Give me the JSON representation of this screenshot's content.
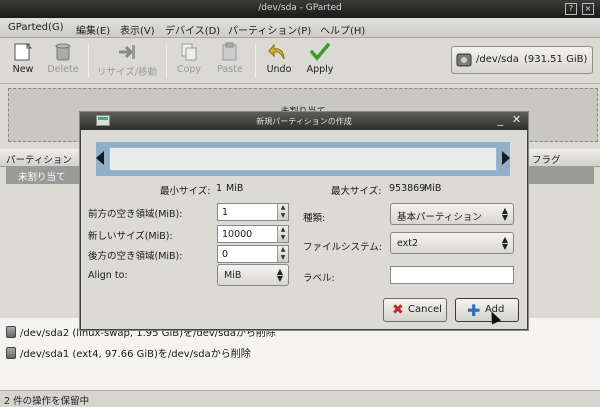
{
  "window": {
    "title": "/dev/sda - GParted",
    "controls": [
      "?",
      "×"
    ]
  },
  "menubar": [
    "GParted(G)",
    "編集(E)",
    "表示(V)",
    "デバイス(D)",
    "パーティション(P)",
    "ヘルプ(H)"
  ],
  "toolbar": {
    "new": "New",
    "delete": "Delete",
    "resize_move": "リサイズ/移動",
    "copy": "Copy",
    "paste": "Paste",
    "undo": "Undo",
    "apply": "Apply"
  },
  "device": {
    "label": "/dev/sda",
    "size": "(931.51 GiB)"
  },
  "disk_map": {
    "unallocated_label": "未割り当て"
  },
  "table": {
    "headers": [
      "パーティション",
      "フラグ"
    ],
    "selected_row": "未割り当て"
  },
  "dialog": {
    "title": "新規パーティションの作成",
    "min_size_label": "最小サイズ:",
    "min_size_value": "1",
    "min_size_unit": "MiB",
    "max_size_label": "最大サイズ:",
    "max_size_value": "953869",
    "max_size_unit": "MiB",
    "free_before_label": "前方の空き領域(MiB):",
    "free_before_value": "1",
    "new_size_label": "新しいサイズ(MiB):",
    "new_size_value": "10000",
    "free_after_label": "後方の空き領域(MiB):",
    "free_after_value": "0",
    "align_label": "Align to:",
    "align_value": "MiB",
    "type_label": "種類:",
    "type_value": "基本パーティション",
    "fs_label": "ファイルシステム:",
    "fs_value": "ext2",
    "label_label": "ラベル:",
    "label_value": "",
    "cancel": "Cancel",
    "add": "Add",
    "cancel_color": "#c0282a",
    "add_color": "#2f6fb5"
  },
  "pending": [
    "/dev/sda2 (linux-swap, 1.95 GiB)を/dev/sdaから削除",
    "/dev/sda1 (ext4, 97.66 GiB)を/dev/sdaから削除"
  ],
  "status": "2 件の操作を保留中"
}
